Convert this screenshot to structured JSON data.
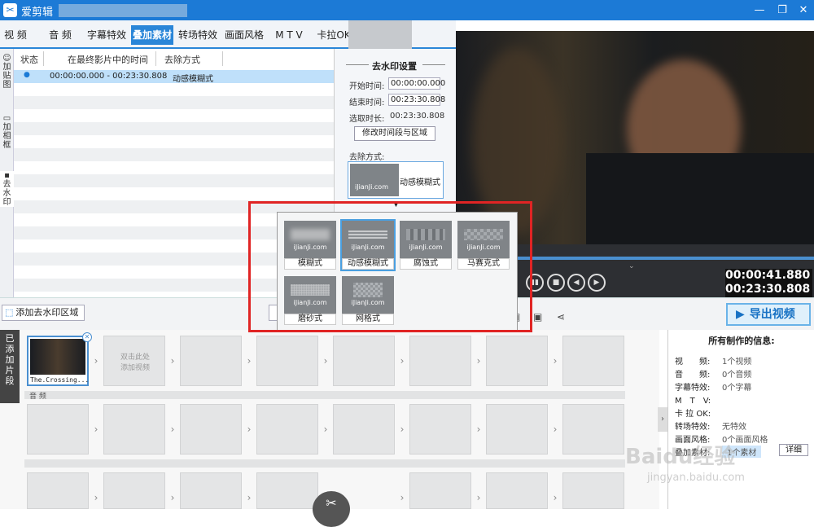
{
  "app": {
    "title": "爱剪辑",
    "icon": "film-icon"
  },
  "tabs": [
    "视 频",
    "音 频",
    "字幕特效",
    "叠加素材",
    "转场特效",
    "画面风格",
    "M T V",
    "卡拉OK"
  ],
  "active_tab": "叠加素材",
  "left_sidebar": [
    {
      "icon": "sticker-icon",
      "label": "加贴图"
    },
    {
      "icon": "frame-icon",
      "label": "加相框"
    },
    {
      "icon": "eraser-icon",
      "label": "去水印"
    }
  ],
  "watermark_list": {
    "headers": [
      "状态",
      "在最终影片中的时间",
      "去除方式"
    ],
    "rows": [
      {
        "status": "●",
        "time": "00:00:00.000 - 00:23:30.808",
        "method": "动感模糊式"
      }
    ]
  },
  "settings": {
    "title": "去水印设置",
    "start_label": "开始时间:",
    "start_value": "00:00:00.000",
    "end_label": "结束时间:",
    "end_value": "00:23:30.808",
    "duration_label": "选取时长:",
    "duration_value": "00:23:30.808",
    "modify_button": "修改时间段与区域",
    "method_label": "去除方式:",
    "method_value": "动感模糊式",
    "method_thumb_text": "iJianJi.com"
  },
  "popup": {
    "options": [
      {
        "label": "模糊式",
        "thumb": "iJianJi.com"
      },
      {
        "label": "动感模糊式",
        "thumb": "iJianJi.com"
      },
      {
        "label": "腐蚀式",
        "thumb": "iJianJi.com"
      },
      {
        "label": "马赛克式",
        "thumb": "iJianJi.com"
      },
      {
        "label": "磨砂式",
        "thumb": "iJianJi.com"
      },
      {
        "label": "网格式",
        "thumb": "iJianJi.com"
      }
    ],
    "selected": "动感模糊式"
  },
  "player": {
    "current_time": "00:00:41.880",
    "total_time": "00:23:30.808"
  },
  "toolbar": {
    "add_area": "添加去水印区域",
    "export": "导出视频"
  },
  "timeline": {
    "side_label": "已添加片段",
    "first_clip": "The.Crossing...",
    "empty_clip": "双击此处\n添加视频",
    "audio_label": "音 频"
  },
  "info": {
    "title": "所有制作的信息:",
    "rows": [
      {
        "k": "视　　频:",
        "v": "1个视频"
      },
      {
        "k": "音　　频:",
        "v": "0个音频"
      },
      {
        "k": "字幕特效:",
        "v": "0个字幕"
      },
      {
        "k": "M　T　V:",
        "v": ""
      },
      {
        "k": "卡 拉 OK:",
        "v": ""
      },
      {
        "k": "转场特效:",
        "v": "无特效"
      },
      {
        "k": "画面风格:",
        "v": "0个画面风格"
      },
      {
        "k": "叠加素材:",
        "v": "1个素材"
      }
    ],
    "detail_button": "详细"
  },
  "watermarks": {
    "baidu": "Baidu经验",
    "url": "jingyan.baidu.com"
  }
}
